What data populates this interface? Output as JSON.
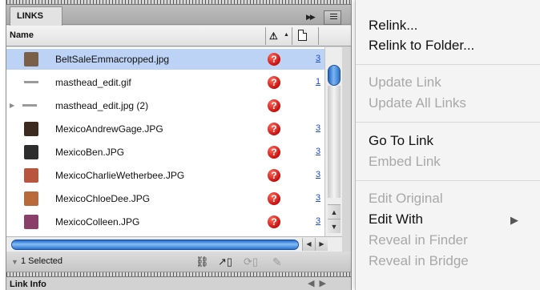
{
  "panel": {
    "tab_label": "LINKS",
    "column_name": "Name",
    "column_status_icon": "warning-triangle-icon",
    "column_page_icon": "page-icon",
    "collapse_icon": "double-chevron-right-icon",
    "panel_menu_icon": "panel-menu-icon"
  },
  "links": [
    {
      "name": "BeltSaleEmmacropped.jpg",
      "status": "missing",
      "page": "3",
      "selected": true,
      "thumb_color": "#7a6048"
    },
    {
      "name": "masthead_edit.gif",
      "status": "missing",
      "page": "1",
      "selected": false,
      "thumb_color": "#9a9a9a"
    },
    {
      "name": "masthead_edit.jpg (2)",
      "status": "missing",
      "page": "",
      "selected": false,
      "thumb_color": "#9a9a9a",
      "has_disclosure": true
    },
    {
      "name": "MexicoAndrewGage.JPG",
      "status": "missing",
      "page": "3",
      "selected": false,
      "thumb_color": "#3b2a20"
    },
    {
      "name": "MexicoBen.JPG",
      "status": "missing",
      "page": "3",
      "selected": false,
      "thumb_color": "#2c2c2c"
    },
    {
      "name": "MexicoCharlieWetherbee.JPG",
      "status": "missing",
      "page": "3",
      "selected": false,
      "thumb_color": "#b8553f"
    },
    {
      "name": "MexicoChloeDee.JPG",
      "status": "missing",
      "page": "3",
      "selected": false,
      "thumb_color": "#b86a3a"
    },
    {
      "name": "MexicoColleen.JPG",
      "status": "missing",
      "page": "3",
      "selected": false,
      "thumb_color": "#8a3f6a"
    }
  ],
  "footer": {
    "selected_count": "1 Selected",
    "relink_icon": "chain-link-icon",
    "goto_icon": "go-to-link-icon",
    "update_icon": "update-link-icon",
    "edit_icon": "edit-original-icon"
  },
  "link_info": {
    "label": "Link Info"
  },
  "menu": {
    "relink": "Relink...",
    "relink_to_folder": "Relink to Folder...",
    "update_link": "Update Link",
    "update_all_links": "Update All Links",
    "go_to_link": "Go To Link",
    "embed_link": "Embed Link",
    "edit_original": "Edit Original",
    "edit_with": "Edit With",
    "reveal_in_finder": "Reveal in Finder",
    "reveal_in_bridge": "Reveal in Bridge",
    "submenu_icon": "chevron-right-icon"
  },
  "colors": {
    "selection": "#bcd3f5",
    "missing_icon": "#c90f0f",
    "scroll_thumb": "#2a73d0",
    "link_blue": "#1d4bd6",
    "disabled_text": "#a8a8a8"
  }
}
